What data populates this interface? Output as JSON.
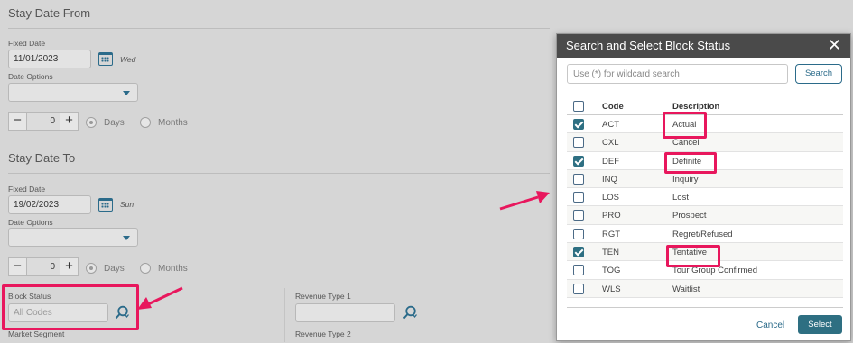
{
  "form": {
    "from": {
      "title": "Stay Date From",
      "fixed_date_label": "Fixed Date",
      "fixed_date_value": "11/01/2023",
      "day": "Wed",
      "date_options_label": "Date Options",
      "stepper_value": "0",
      "days_label": "Days",
      "months_label": "Months"
    },
    "to": {
      "title": "Stay Date To",
      "fixed_date_label": "Fixed Date",
      "fixed_date_value": "19/02/2023",
      "day": "Sun",
      "date_options_label": "Date Options",
      "stepper_value": "0",
      "days_label": "Days",
      "months_label": "Months"
    },
    "block_status_label": "Block Status",
    "block_status_placeholder": "All Codes",
    "revenue_type_1_label": "Revenue Type 1",
    "market_segment_label": "Market Segment",
    "revenue_type_2_label": "Revenue Type 2",
    "stepper_minus": "−",
    "stepper_plus": "+"
  },
  "dialog": {
    "title": "Search and Select Block Status",
    "close_glyph": "✕",
    "search_placeholder": "Use (*) for wildcard search",
    "search_button": "Search",
    "columns": {
      "code": "Code",
      "description": "Description"
    },
    "rows": [
      {
        "code": "ACT",
        "description": "Actual",
        "checked": true
      },
      {
        "code": "CXL",
        "description": "Cancel",
        "checked": false
      },
      {
        "code": "DEF",
        "description": "Definite",
        "checked": true
      },
      {
        "code": "INQ",
        "description": "Inquiry",
        "checked": false
      },
      {
        "code": "LOS",
        "description": "Lost",
        "checked": false
      },
      {
        "code": "PRO",
        "description": "Prospect",
        "checked": false
      },
      {
        "code": "RGT",
        "description": "Regret/Refused",
        "checked": false
      },
      {
        "code": "TEN",
        "description": "Tentative",
        "checked": true
      },
      {
        "code": "TOG",
        "description": "Tour Group Confirmed",
        "checked": false
      },
      {
        "code": "WLS",
        "description": "Waitlist",
        "checked": false
      }
    ],
    "cancel_label": "Cancel",
    "select_label": "Select"
  },
  "colors": {
    "accent": "#2e6f82",
    "highlight": "#e8175d",
    "header": "#4a4a4a"
  },
  "icons": [
    "calendar-icon",
    "chevron-down-icon",
    "lookup-search-icon",
    "close-icon",
    "checkbox-icon",
    "annotation-arrow"
  ]
}
